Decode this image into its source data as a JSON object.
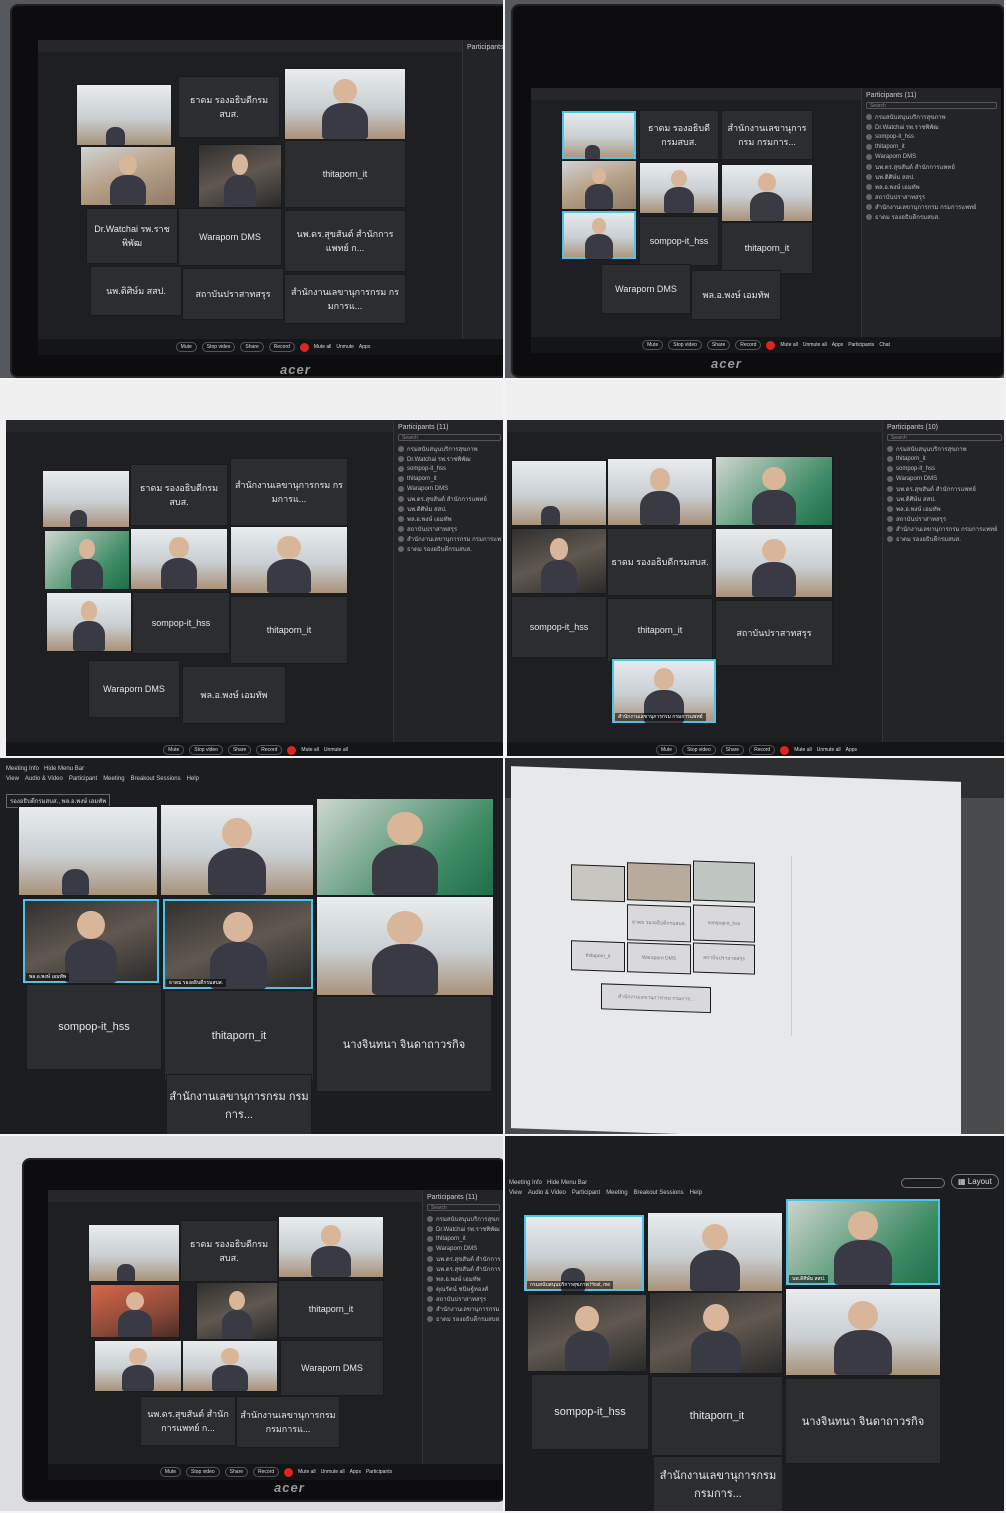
{
  "monitor_brand": "acer",
  "photo1": {
    "tiles": [
      "ธาดม รองอธิบดีกรมสบส.",
      "thitaporn_it",
      "Dr.Watchai รพ.ราชพิพัฒ",
      "Waraporn DMS",
      "นพ.ดร.สุขสันต์ สำนักการแพทย์ ก...",
      "นพ.ดิศิษ์ม สสป.",
      "สถาบันปราสาทสรุร",
      "สำนักงานเลขานุการกรม กรมการแ..."
    ],
    "panel_title": "Participants",
    "toolbar": [
      "Mute",
      "Stop video",
      "Share",
      "Record"
    ],
    "side": [
      "Mute all",
      "Unmute"
    ],
    "apps": "Apps"
  },
  "photo2": {
    "tiles": [
      "ธาดม รองอธิบดีกรมสบส.",
      "สำนักงานเลขานุการกรม กรมการ...",
      "sompop-it_hss",
      "thitaporn_it",
      "Waraporn DMS",
      "พล.อ.พงษ์ เอมทัพ"
    ],
    "panel_title": "Participants (11)",
    "search": "Search",
    "participants": [
      "กรมสนับสนุนบริการสุขภาพ",
      "Dr.Watchai รพ.ราชพิพัฒ",
      "sompop-it_hss",
      "thitaporn_it",
      "Waraporn DMS",
      "นพ.ดร.สุขสันต์ สำนักการแพทย์",
      "นพ.ดิศิษ์ม สสป.",
      "พล.อ.พงษ์ เอมทัพ",
      "สถาบันปราสาทสรุร",
      "สำนักงานเลขานุการกรม กรมการแพทย์",
      "ธาดม รองอธิบดีกรมสบส."
    ],
    "toolbar": [
      "Mute",
      "Stop video",
      "Share",
      "Record"
    ],
    "side": [
      "Mute all",
      "Unmute all"
    ],
    "apps": "Apps",
    "participants_btn": "Participants",
    "chat": "Chat"
  },
  "photo3": {
    "tiles": [
      "ธาดม รองอธิบดีกรมสบส.",
      "สำนักงานเลขานุการกรม กรมการแ...",
      "sompop-it_hss",
      "thitaporn_it",
      "Waraporn DMS",
      "พล.อ.พงษ์ เอมทัพ"
    ],
    "panel_title": "Participants (11)",
    "search": "Search",
    "participants": [
      "กรมสนับสนุนบริการสุขภาพ",
      "Dr.Watchai รพ.ราชพิพัฒ",
      "sompop-it_hss",
      "thitaporn_it",
      "Waraporn DMS",
      "นพ.ดร.สุขสันต์ สำนักการแพทย์",
      "นพ.ดิศิษ์ม สสป.",
      "พล.อ.พงษ์ เอมทัพ",
      "สถาบันปราสาทสรุร",
      "สำนักงานเลขานุการกรม กรมการแพทย์",
      "ธาดม รองอธิบดีกรมสบส."
    ],
    "toolbar": [
      "Mute",
      "Stop video",
      "Share",
      "Record"
    ],
    "side": [
      "Mute all",
      "Unmute all"
    ]
  },
  "photo4": {
    "tiles": [
      "ธาดม รองอธิบดีกรมสบส.",
      "sompop-it_hss",
      "thitaporn_it",
      "สถาบันปราสาทสรุร"
    ],
    "active_name": "สำนักงานเลขานุการกรม กรมการแพทย์",
    "panel_title": "Participants (10)",
    "search": "Search",
    "participants": [
      "กรมสนับสนุนบริการสุขภาพ",
      "thitaporn_it",
      "sompop-it_hss",
      "Waraporn DMS",
      "นพ.ดร.สุขสันต์ สำนักการแพทย์",
      "นพ.ดิศิษ์ม สสป.",
      "พล.อ.พงษ์ เอมทัพ",
      "สถาบันปราสาทสรุร",
      "สำนักงานเลขานุการกรม กรมการแพทย์",
      "ธาดม รองอธิบดีกรมสบส."
    ],
    "toolbar": [
      "Mute",
      "Stop video",
      "Share",
      "Record"
    ],
    "side": [
      "Mute all",
      "Unmute all"
    ],
    "apps": "Apps"
  },
  "photo5": {
    "menubar": [
      "Meeting Info",
      "Hide Menu Bar"
    ],
    "menu": [
      "View",
      "Audio & Video",
      "Participant",
      "Meeting",
      "Breakout Sessions",
      "Help"
    ],
    "active_speaker": "รองอธิบดีกรมสบส., พล.อ.พงษ์ เอมทัพ",
    "video_names": [
      "พล.อ.พงษ์ เอมทัพ",
      "ธาดม รองอธิบดีกรมสบส."
    ],
    "tiles": [
      "sompop-it_hss",
      "thitaporn_it",
      "นางจินทนา จินดาถาวรกิจ",
      "สำนักงานเลขานุการกรม กรมการ..."
    ]
  },
  "photo6": {
    "tiles": [
      "ธาดม รองอธิบดีกรมสบส.",
      "sompop-it_hss",
      "thitaporn_it",
      "Waraporn DMS",
      "สถาบันปราสาทสรุร",
      "สำนักงานเลขานุการกรม กรมการ..."
    ]
  },
  "photo7": {
    "tiles": [
      "ธาดม รองอธิบดีกรมสบส.",
      "thitaporn_it",
      "Waraporn DMS",
      "นพ.ดร.สุขสันต์ สำนักการแพทย์ ก...",
      "สำนักงานเลขานุการกรม กรมการแ..."
    ],
    "panel_title": "Participants (11)",
    "search": "Search",
    "participants": [
      "กรมสนับสนุนบริการสุขภาพ",
      "Dr.Watchai รพ.ราชพิพัฒ",
      "thitaporn_it",
      "Waraporn DMS",
      "นพ.ดร.สุขสันต์ สำนักการแพทย์",
      "นพ.ดร.สุขสันต์ สำนักการแพทย์",
      "พล.อ.พงษ์ เอมทัพ",
      "คุณรัตน์ ชนิษฐ์ทองศ์",
      "สถาบันปราสาทสรุร",
      "สำนักงานเลขานุการกรม กรมการแพทย์",
      "ธาดม รองอธิบดีกรมสบส."
    ],
    "toolbar": [
      "Mute",
      "Stop video",
      "Share",
      "Record"
    ],
    "side": [
      "Mute all",
      "Unmute all"
    ],
    "apps": "Apps",
    "participants_btn": "Participants"
  },
  "photo8": {
    "layout_btn": "Layout",
    "menubar": [
      "Meeting Info",
      "Hide Menu Bar"
    ],
    "menu": [
      "View",
      "Audio & Video",
      "Participant",
      "Meeting",
      "Breakout Sessions",
      "Help"
    ],
    "video_names": [
      "กรมสนับสนุนบริการสุขภาพ  Host, me",
      "นพ.ดิศิษ์ม สสป."
    ],
    "tiles": [
      "sompop-it_hss",
      "thitaporn_it",
      "นางจินทนา จินดาถาวรกิจ",
      "สำนักงานเลขานุการกรม กรมการ..."
    ]
  }
}
